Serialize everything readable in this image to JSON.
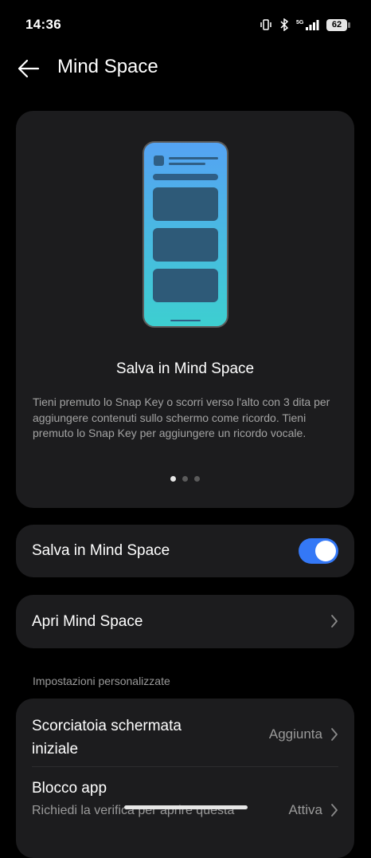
{
  "status_bar": {
    "time": "14:36",
    "battery": "62",
    "icons": [
      "vibrate-icon",
      "bluetooth-icon",
      "5g-signal-icon",
      "battery-icon"
    ]
  },
  "header": {
    "title": "Mind Space"
  },
  "hero": {
    "title": "Salva in Mind Space",
    "description": "Tieni premuto lo Snap Key o scorri verso l'alto con 3 dita per aggiungere contenuti sullo schermo come ricordo. Tieni premuto lo Snap Key per aggiungere un ricordo vocale.",
    "page_indicator": {
      "count": 3,
      "active": 1
    }
  },
  "settings_main": {
    "save_label": "Salva in Mind Space",
    "save_enabled": true,
    "open_label": "Apri Mind Space"
  },
  "custom_settings": {
    "section_title": "Impostazioni personalizzate",
    "shortcut_label_line1": "Scorciatoia schermata",
    "shortcut_label_line2": "iniziale",
    "shortcut_value": "Aggiunta",
    "app_lock_label": "Blocco app",
    "app_lock_desc": "Richiedi la verifica per aprire questa",
    "app_lock_value": "Attiva"
  },
  "colors": {
    "accent": "#3478f6",
    "card": "#1c1c1e",
    "background": "#000000"
  }
}
